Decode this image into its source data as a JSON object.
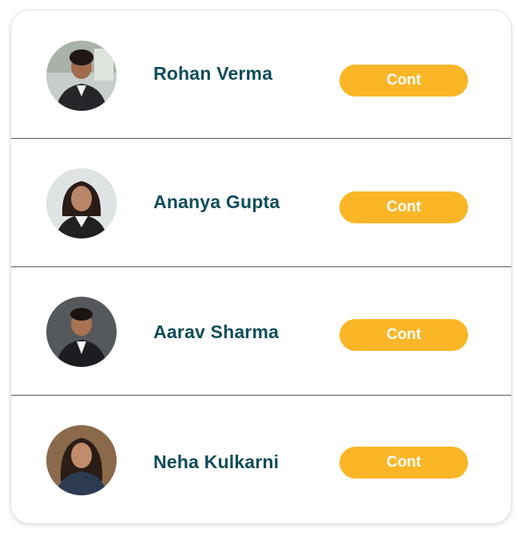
{
  "contacts": [
    {
      "name": "Rohan Verma",
      "button_label": "Cont"
    },
    {
      "name": "Ananya Gupta",
      "button_label": "Cont"
    },
    {
      "name": "Aarav Sharma",
      "button_label": "Cont"
    },
    {
      "name": "Neha Kulkarni",
      "button_label": "Cont"
    }
  ],
  "colors": {
    "name_text": "#0f4d5a",
    "button_bg": "#fab627",
    "button_text": "#ffffff",
    "divider": "#555b5e"
  }
}
